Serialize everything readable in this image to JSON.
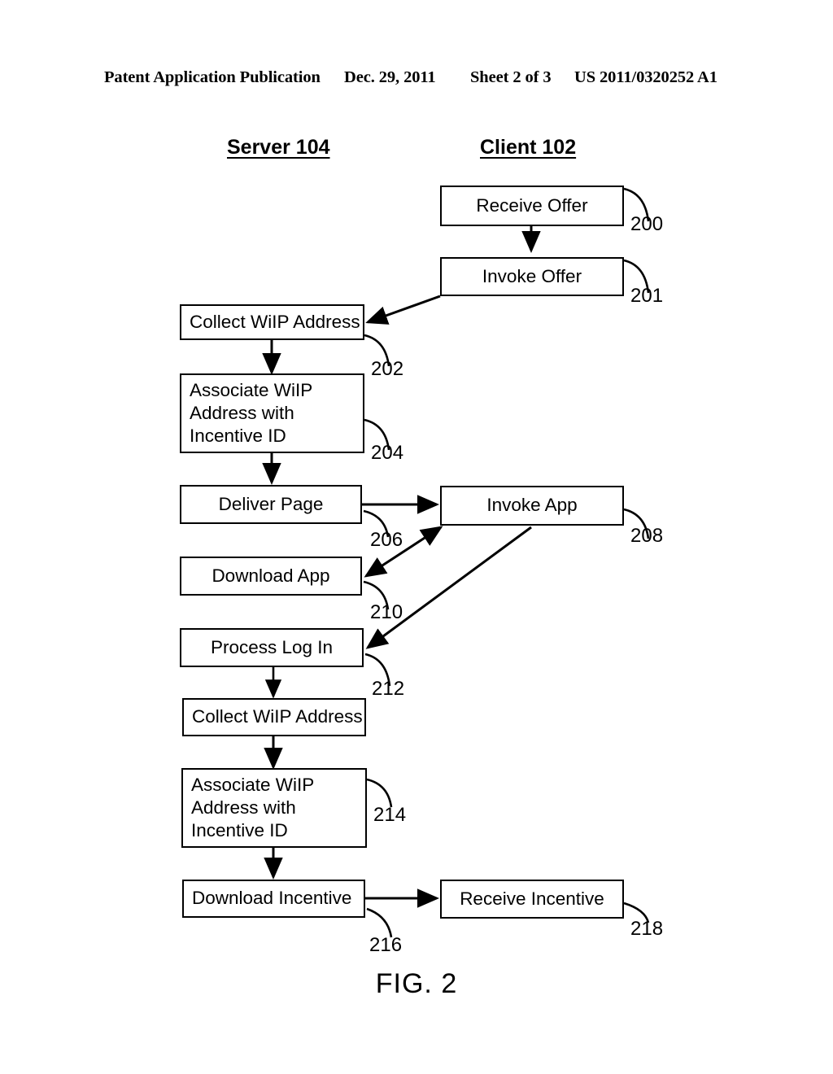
{
  "header": {
    "publication": "Patent Application Publication",
    "date": "Dec. 29, 2011",
    "sheet": "Sheet 2 of 3",
    "patent_number": "US 2011/0320252 A1"
  },
  "columns": {
    "server": "Server 104",
    "client": "Client 102"
  },
  "figure": {
    "caption": "FIG. 2"
  },
  "nodes": {
    "receive_offer": {
      "label": "Receive Offer",
      "ref": "200",
      "lane": "client"
    },
    "invoke_offer": {
      "label": "Invoke Offer",
      "ref": "201",
      "lane": "client"
    },
    "collect_wiip_1": {
      "label": "Collect WiIP Address",
      "ref": "202",
      "lane": "server"
    },
    "associate_wiip_1": {
      "label": "Associate WiIP Address with Incentive ID",
      "ref": "204",
      "lane": "server"
    },
    "deliver_page": {
      "label": "Deliver Page",
      "ref": "206",
      "lane": "server"
    },
    "invoke_app": {
      "label": "Invoke App",
      "ref": "208",
      "lane": "client"
    },
    "download_app": {
      "label": "Download App",
      "ref": "210",
      "lane": "server"
    },
    "process_log_in": {
      "label": "Process Log In",
      "ref": "212",
      "lane": "server"
    },
    "collect_wiip_2": {
      "label": "Collect WiIP Address",
      "ref": "",
      "lane": "server"
    },
    "associate_wiip_2": {
      "label": "Associate WiIP Address with Incentive ID",
      "ref": "214",
      "lane": "server"
    },
    "download_incentive": {
      "label": "Download Incentive",
      "ref": "216",
      "lane": "server"
    },
    "receive_incentive": {
      "label": "Receive Incentive",
      "ref": "218",
      "lane": "client"
    }
  },
  "associate_lines": {
    "line1": "Associate WiIP",
    "line2": "Address with",
    "line3": "Incentive ID"
  },
  "colors": {
    "ink": "#000000",
    "paper": "#ffffff"
  }
}
